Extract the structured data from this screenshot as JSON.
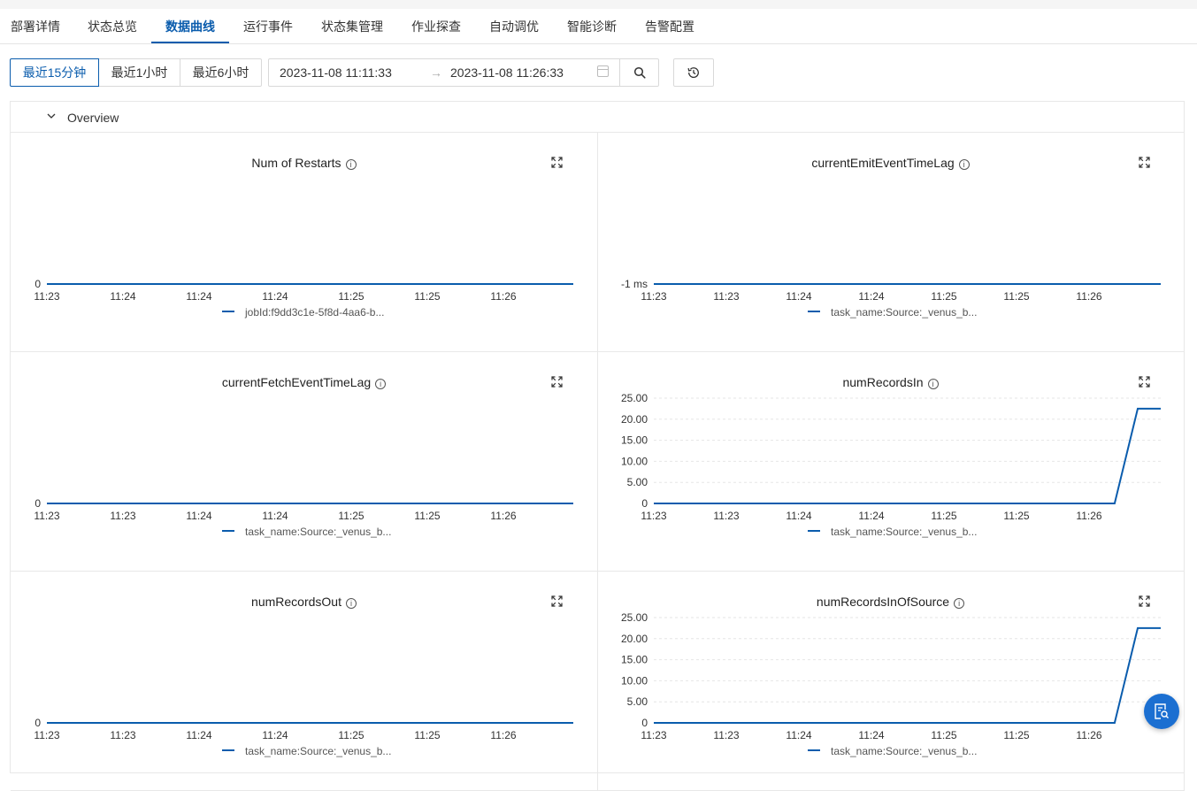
{
  "tabs": [
    {
      "label": "部署详情",
      "active": false
    },
    {
      "label": "状态总览",
      "active": false
    },
    {
      "label": "数据曲线",
      "active": true
    },
    {
      "label": "运行事件",
      "active": false
    },
    {
      "label": "状态集管理",
      "active": false
    },
    {
      "label": "作业探查",
      "active": false
    },
    {
      "label": "自动调优",
      "active": false
    },
    {
      "label": "智能诊断",
      "active": false
    },
    {
      "label": "告警配置",
      "active": false
    }
  ],
  "toolbar": {
    "quick_ranges": [
      "最近15分钟",
      "最近1小时",
      "最近6小时"
    ],
    "active_range": "最近15分钟",
    "start_time": "2023-11-08 11:11:33",
    "arrow": "→",
    "end_time": "2023-11-08 11:26:33"
  },
  "icons": {
    "calendar": "calendar-icon",
    "search": "search-icon",
    "history": "history-icon",
    "expand": "expand-icon",
    "info": "info-icon",
    "collapse": "chevron-down-icon",
    "assistant": "search-doc-icon"
  },
  "colors": {
    "accent": "#0a5cad",
    "series": "#0a5cad",
    "fab": "#1b6fd1"
  },
  "panel": {
    "title": "Overview"
  },
  "chart_data": [
    {
      "type": "line",
      "title": "Num of Restarts",
      "x": [
        "11:23",
        "11:24",
        "11:24",
        "11:24",
        "11:25",
        "11:25",
        "11:26"
      ],
      "y_ticks": [
        "0"
      ],
      "series": [
        {
          "name": "jobId:f9dd3c1e-5f8d-4aa6-b...",
          "values": [
            0,
            0,
            0,
            0,
            0,
            0,
            0,
            0
          ]
        }
      ],
      "ylim": [
        0,
        0
      ]
    },
    {
      "type": "line",
      "title": "currentEmitEventTimeLag",
      "x": [
        "11:23",
        "11:23",
        "11:24",
        "11:24",
        "11:25",
        "11:25",
        "11:26"
      ],
      "y_ticks": [
        "-1 ms"
      ],
      "series": [
        {
          "name": "task_name:Source:_venus_b...",
          "values": [
            -1,
            -1,
            -1,
            -1,
            -1,
            -1,
            -1,
            -1
          ]
        }
      ],
      "ylim": [
        -1,
        -1
      ]
    },
    {
      "type": "line",
      "title": "currentFetchEventTimeLag",
      "x": [
        "11:23",
        "11:23",
        "11:24",
        "11:24",
        "11:25",
        "11:25",
        "11:26"
      ],
      "y_ticks": [
        "0"
      ],
      "series": [
        {
          "name": "task_name:Source:_venus_b...",
          "values": [
            0,
            0,
            0,
            0,
            0,
            0,
            0,
            0
          ]
        }
      ],
      "ylim": [
        0,
        0
      ]
    },
    {
      "type": "line",
      "title": "numRecordsIn",
      "x": [
        "11:23",
        "11:23",
        "11:24",
        "11:24",
        "11:25",
        "11:25",
        "11:26"
      ],
      "y_ticks": [
        "0",
        "5.00",
        "10.00",
        "15.00",
        "20.00",
        "25.00"
      ],
      "series": [
        {
          "name": "task_name:Source:_venus_b...",
          "values": [
            0,
            0,
            0,
            0,
            0,
            0,
            0,
            0,
            0,
            0,
            0,
            0,
            0,
            0,
            0,
            0,
            0,
            0,
            0,
            0,
            0,
            22.5,
            22.5
          ]
        }
      ],
      "ylim": [
        0,
        25
      ]
    },
    {
      "type": "line",
      "title": "numRecordsOut",
      "x": [
        "11:23",
        "11:23",
        "11:24",
        "11:24",
        "11:25",
        "11:25",
        "11:26"
      ],
      "y_ticks": [
        "0"
      ],
      "series": [
        {
          "name": "task_name:Source:_venus_b...",
          "values": [
            0,
            0,
            0,
            0,
            0,
            0,
            0,
            0
          ]
        }
      ],
      "ylim": [
        0,
        0
      ]
    },
    {
      "type": "line",
      "title": "numRecordsInOfSource",
      "x": [
        "11:23",
        "11:23",
        "11:24",
        "11:24",
        "11:25",
        "11:25",
        "11:26"
      ],
      "y_ticks": [
        "0",
        "5.00",
        "10.00",
        "15.00",
        "20.00",
        "25.00"
      ],
      "series": [
        {
          "name": "task_name:Source:_venus_b...",
          "values": [
            0,
            0,
            0,
            0,
            0,
            0,
            0,
            0,
            0,
            0,
            0,
            0,
            0,
            0,
            0,
            0,
            0,
            0,
            0,
            0,
            0,
            22.5,
            22.5
          ]
        }
      ],
      "ylim": [
        0,
        25
      ]
    }
  ]
}
